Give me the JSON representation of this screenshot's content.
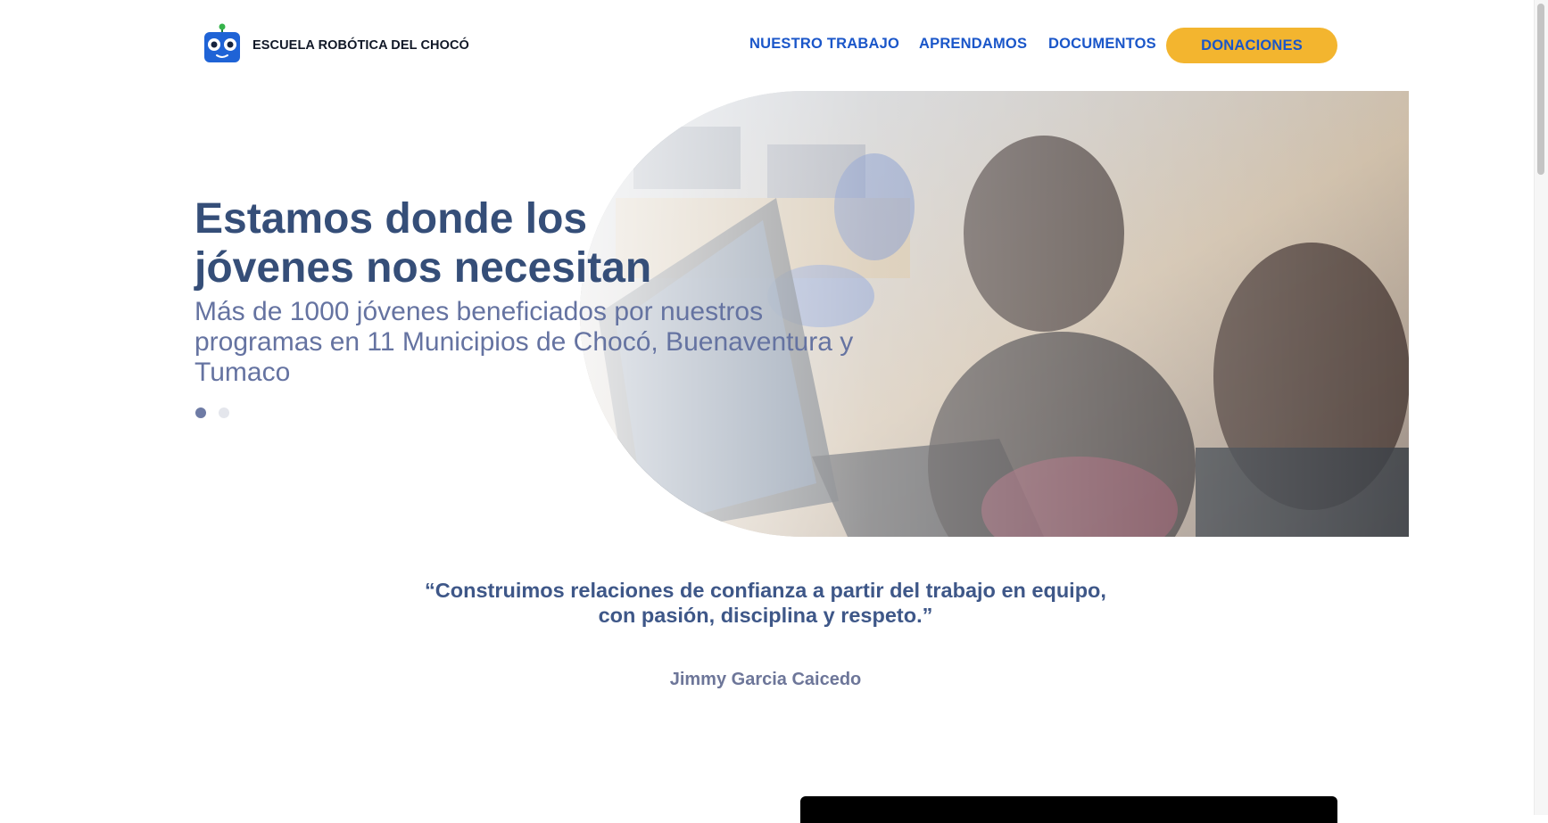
{
  "header": {
    "brand": "ESCUELA ROBÓTICA DEL CHOCÓ",
    "logo_icon": "robot-logo-icon",
    "nav": [
      "NUESTRO TRABAJO",
      "APRENDAMOS",
      "DOCUMENTOS"
    ],
    "donate_label": "DONACIONES"
  },
  "hero": {
    "title": "Estamos donde los jóvenes nos necesitan",
    "subtitle": "Más de 1000 jóvenes beneficiados por nuestros programas en 11 Municipios de Chocó, Buenaventura y Tumaco",
    "slides_total": 2,
    "active_slide": 1
  },
  "testimonial": {
    "quote": "“Construimos relaciones de confianza a partir del trabajo en equipo, con pasión, disciplina y respeto.”",
    "author": "Jimmy Garcia Caicedo"
  },
  "colors": {
    "brand_blue": "#1a56c9",
    "accent_yellow": "#f3b52f",
    "title_navy": "#354e78",
    "subtitle_slate": "#6573a1"
  }
}
